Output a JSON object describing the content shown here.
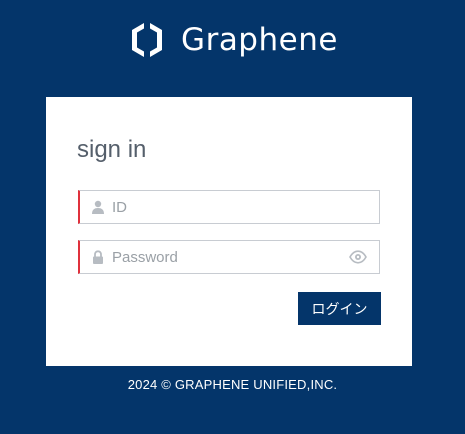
{
  "brand": {
    "name": "Graphene",
    "logo_icon": "hexagon-logo-icon"
  },
  "login": {
    "heading": "sign in",
    "id_field": {
      "placeholder": "ID",
      "value": "",
      "icon": "user-icon"
    },
    "password_field": {
      "placeholder": "Password",
      "value": "",
      "icon": "lock-icon",
      "toggle_icon": "eye-icon"
    },
    "submit_label": "ログイン"
  },
  "footer": {
    "copyright": "2024 © GRAPHENE UNIFIED,INC."
  },
  "colors": {
    "background": "#04356a",
    "card": "#ffffff",
    "accent_border": "#e0313c",
    "button": "#04356a"
  }
}
